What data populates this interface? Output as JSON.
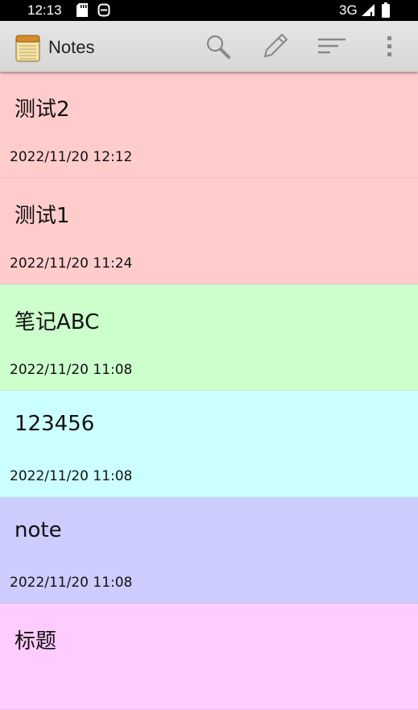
{
  "status_bar": {
    "time": "12:13",
    "network": "3G"
  },
  "app_bar": {
    "title": "Notes",
    "actions": [
      "search-icon",
      "pencil-icon",
      "sort-icon",
      "overflow-menu-icon"
    ]
  },
  "notes": [
    {
      "title": "测试2",
      "date": "2022/11/20 12:12",
      "color": "#ffcccc"
    },
    {
      "title": "测试1",
      "date": "2022/11/20 11:24",
      "color": "#ffcccc"
    },
    {
      "title": "笔记ABC",
      "date": "2022/11/20 11:08",
      "color": "#ccffcc"
    },
    {
      "title": "123456",
      "date": "2022/11/20 11:08",
      "color": "#ccffff"
    },
    {
      "title": "note",
      "date": "2022/11/20 11:08",
      "color": "#ccccff"
    },
    {
      "title": "标题",
      "date": "",
      "color": "#ffccff"
    }
  ]
}
